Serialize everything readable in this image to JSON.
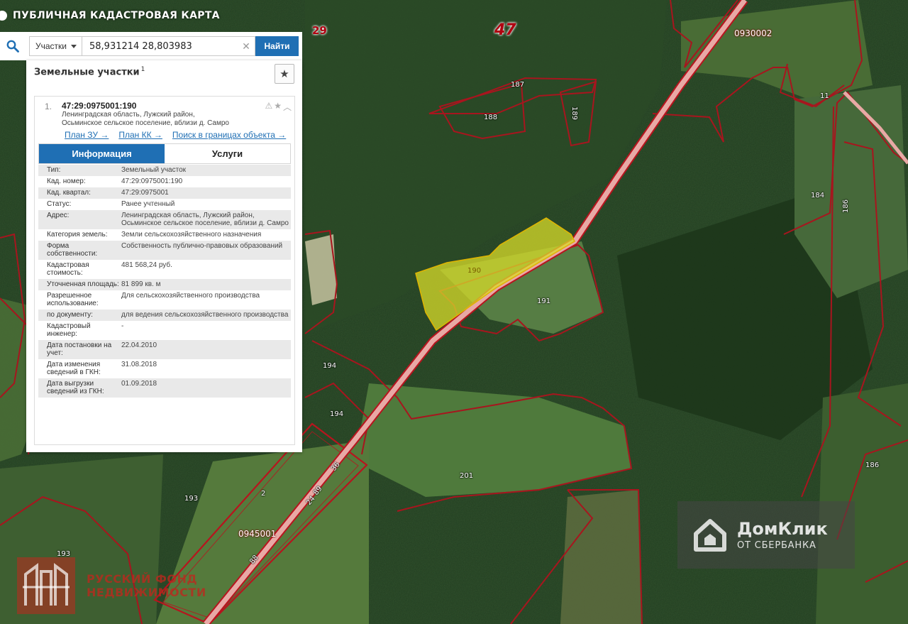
{
  "app": {
    "title": "ПУБЛИЧНАЯ КАДАСТРОВАЯ КАРТА",
    "logo_icon": "globe-icon"
  },
  "search": {
    "type_label": "Участки",
    "value": "58,931214 28,803983",
    "button_label": "Найти",
    "search_icon": "search-icon",
    "clear_icon": "close-icon"
  },
  "results": {
    "heading": "Земельные участки",
    "count": "1",
    "favorites_icon": "star-icon",
    "items": [
      {
        "index": "1.",
        "cad_number": "47:29:0975001:190",
        "address_lines": [
          "Ленинградская область, Лужский район,",
          "Осьминское сельское поселение, вблизи д. Самро"
        ],
        "links": {
          "plan_zu": "План ЗУ →",
          "plan_kk": "План КК →",
          "search_in_bounds": "Поиск в границах объекта →"
        },
        "tabs": {
          "info": "Информация",
          "services": "Услуги"
        },
        "info": [
          {
            "key": "Тип:",
            "value": "Земельный участок"
          },
          {
            "key": "Кад. номер:",
            "value": "47:29:0975001:190",
            "link": true
          },
          {
            "key": "Кад. квартал:",
            "value": "47:29:0975001",
            "link": true
          },
          {
            "key": "Статус:",
            "value": "Ранее учтенный"
          },
          {
            "key": "Адрес:",
            "value": "Ленинградская область, Лужский район, Осьминское сельское поселение, вблизи д. Самро"
          },
          {
            "key": "Категория земель:",
            "value": "Земли сельскохозяйственного назначения"
          },
          {
            "key": "Форма собственности:",
            "value": "Собственность публично-правовых образований"
          },
          {
            "key": "Кадастровая стоимость:",
            "value": "481 568,24 руб."
          },
          {
            "key": "Уточненная площадь:",
            "value": "81 899 кв. м"
          },
          {
            "key": "Разрешенное использование:",
            "value": "Для сельскохозяйственного производства"
          },
          {
            "key": "по документу:",
            "value": "для ведения сельскохозяйственного производства"
          },
          {
            "key": "Кадастровый инженер:",
            "value": "-"
          },
          {
            "key": "Дата постановки на учет:",
            "value": "22.04.2010"
          },
          {
            "key": "Дата изменения сведений в ГКН:",
            "value": "31.08.2018"
          },
          {
            "key": "Дата выгрузки сведений из ГКН:",
            "value": "01.09.2018"
          }
        ]
      }
    ]
  },
  "map": {
    "region_number": "47",
    "district_number": "29",
    "quarter_labels": {
      "q_0945001": "0945001",
      "q_0930002": "0930002"
    },
    "parcel_labels": {
      "p190": "190",
      "p191": "191",
      "p187": "187",
      "p188": "188",
      "p189": "189",
      "p184": "184",
      "p186a": "186",
      "p186b": "186",
      "p194a": "194",
      "p194b": "194",
      "p201": "201",
      "p193a": "193",
      "p193b": "193",
      "p11": "11",
      "p2": "2",
      "p24": "24",
      "p89": "89",
      "p36": "36",
      "p88": "88"
    },
    "colors": {
      "forest": "#1f3a1e",
      "boundary": "#a8151e",
      "road": "#e7a8a4",
      "selected_fill": "#d8dc2a",
      "selected_stroke": "#e0b400"
    }
  },
  "watermarks": {
    "domclick_title": "ДомКлик",
    "domclick_sub": "ОТ СБЕРБАНКА",
    "rfn_lines": [
      "РУССКИЙ ФОНД",
      "НЕДВИЖИМОСТИ"
    ]
  }
}
